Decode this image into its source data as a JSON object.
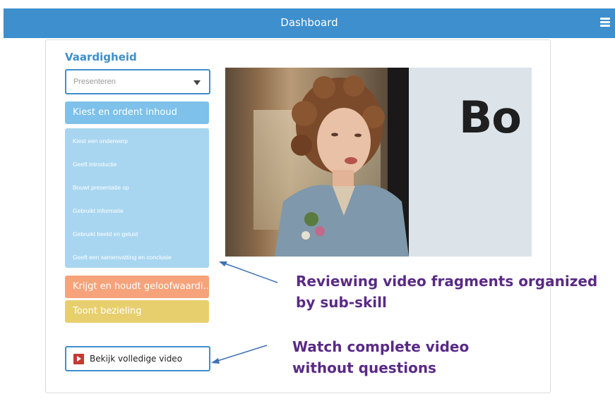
{
  "header": {
    "title": "Dashboard",
    "menu_icon": "hamburger-menu-icon"
  },
  "sidebar": {
    "section_label": "Vaardigheid",
    "select_value": "Presenteren",
    "skills": [
      {
        "label": "Kiest en ordent inhoud",
        "color": "#7ec1ea",
        "subskills": [
          "Kiest een onderwerp",
          "Geeft introductie",
          "Bouwt presentatie op",
          "Gebruikt informatie",
          "Gebruikt beeld en geluid",
          "Geeft een samenvatting en conclusie"
        ]
      },
      {
        "label": "Krijgt en houdt geloofwaardi...",
        "color": "#f6a27a"
      },
      {
        "label": "Toont bezieling",
        "color": "#e8cf6e"
      }
    ],
    "watch_button": {
      "label": "Bekijk volledige video",
      "icon": "play-icon"
    }
  },
  "video": {
    "board_text": "Bo"
  },
  "annotations": {
    "fragments": [
      "Reviewing video fragments organized",
      "by sub-skill"
    ],
    "complete": [
      "Watch complete video",
      "without questions"
    ]
  },
  "colors": {
    "header": "#3d8fcd",
    "annotation": "#5a2a86",
    "accent": "#3d8fcd"
  }
}
